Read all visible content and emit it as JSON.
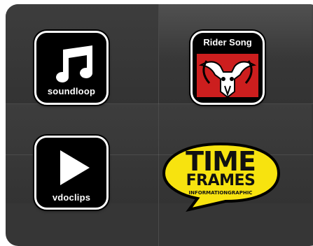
{
  "apps": {
    "soundloop": {
      "label": "soundloop",
      "icon": "music-note-icon"
    },
    "rider_song": {
      "title": "Rider Song",
      "icon": "bull-skull-icon"
    },
    "vdoclips": {
      "label": "vdoclips",
      "icon": "play-icon"
    },
    "time_frames": {
      "line1": "TIME",
      "line2": "FRAMES",
      "line3": "INFORMATIONGRAPHIC",
      "icon": "speech-bubble-icon"
    }
  },
  "colors": {
    "panel": "#363636",
    "icon_bg": "#000000",
    "rider_red": "#cc1e1e",
    "time_frames_yellow": "#f7e30f"
  }
}
